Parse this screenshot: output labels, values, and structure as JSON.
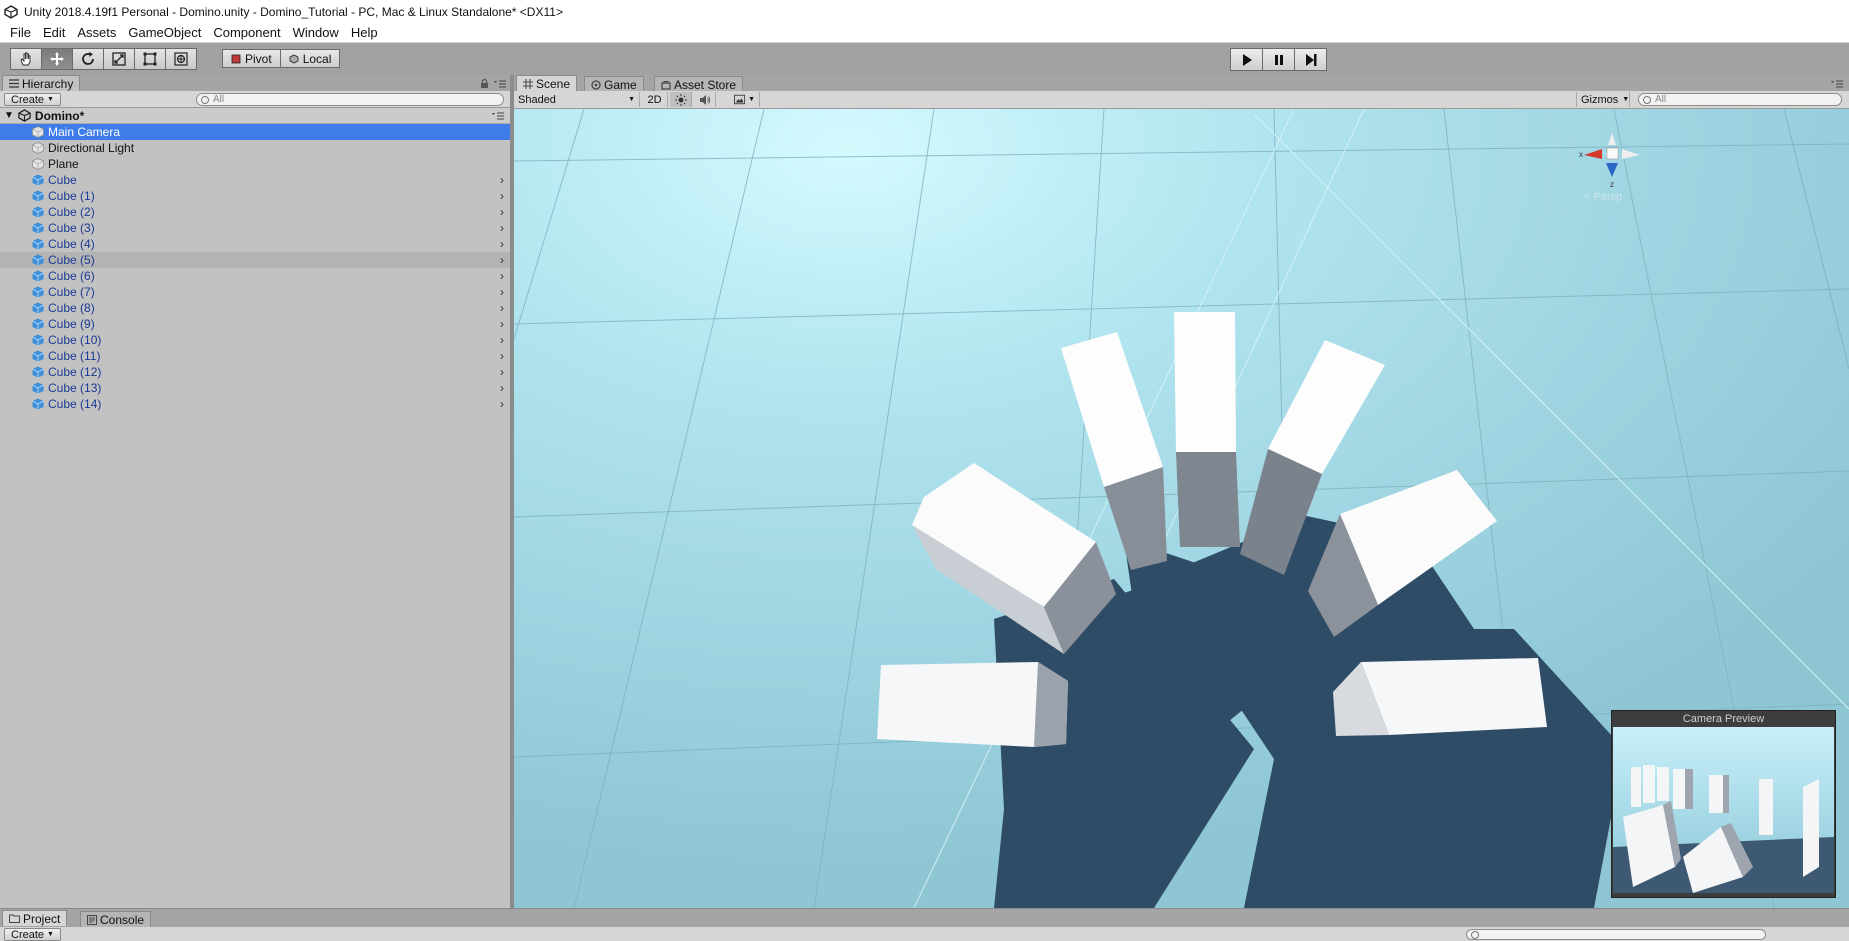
{
  "window": {
    "title": "Unity 2018.4.19f1 Personal - Domino.unity - Domino_Tutorial - PC, Mac & Linux Standalone* <DX11>"
  },
  "menu": [
    "File",
    "Edit",
    "Assets",
    "GameObject",
    "Component",
    "Window",
    "Help"
  ],
  "toolbar": {
    "tools": [
      "hand-icon",
      "move-icon",
      "rotate-icon",
      "scale-icon",
      "rect-icon",
      "transform-icon"
    ],
    "active_tool": "move-icon",
    "pivot_label": "Pivot",
    "local_label": "Local",
    "play_controls": [
      "play-icon",
      "pause-icon",
      "step-icon"
    ]
  },
  "hierarchy": {
    "tab_label": "Hierarchy",
    "create_label": "Create",
    "search_placeholder": "All",
    "scene_name": "Domino*",
    "items": [
      {
        "label": "Main Camera",
        "icon": "gameobject-icon",
        "selected": true
      },
      {
        "label": "Directional Light",
        "icon": "gameobject-icon"
      },
      {
        "label": "Plane",
        "icon": "gameobject-icon"
      },
      {
        "label": "Cube",
        "icon": "prefab-icon",
        "prefab": true
      },
      {
        "label": "Cube (1)",
        "icon": "prefab-icon",
        "prefab": true
      },
      {
        "label": "Cube (2)",
        "icon": "prefab-icon",
        "prefab": true
      },
      {
        "label": "Cube (3)",
        "icon": "prefab-icon",
        "prefab": true
      },
      {
        "label": "Cube (4)",
        "icon": "prefab-icon",
        "prefab": true
      },
      {
        "label": "Cube (5)",
        "icon": "prefab-icon",
        "prefab": true,
        "hovered": true
      },
      {
        "label": "Cube (6)",
        "icon": "prefab-icon",
        "prefab": true
      },
      {
        "label": "Cube (7)",
        "icon": "prefab-icon",
        "prefab": true
      },
      {
        "label": "Cube (8)",
        "icon": "prefab-icon",
        "prefab": true
      },
      {
        "label": "Cube (9)",
        "icon": "prefab-icon",
        "prefab": true
      },
      {
        "label": "Cube (10)",
        "icon": "prefab-icon",
        "prefab": true
      },
      {
        "label": "Cube (11)",
        "icon": "prefab-icon",
        "prefab": true
      },
      {
        "label": "Cube (12)",
        "icon": "prefab-icon",
        "prefab": true
      },
      {
        "label": "Cube (13)",
        "icon": "prefab-icon",
        "prefab": true
      },
      {
        "label": "Cube (14)",
        "icon": "prefab-icon",
        "prefab": true
      }
    ]
  },
  "scene_view": {
    "tabs": [
      "Scene",
      "Game",
      "Asset Store"
    ],
    "active_tab": "Scene",
    "shading_mode": "Shaded",
    "mode_2d_label": "2D",
    "gizmos_label": "Gizmos",
    "search_placeholder": "All",
    "gizmo_axes": {
      "x": "x",
      "z": "z"
    },
    "projection_label": "Persp",
    "camera_preview_title": "Camera Preview"
  },
  "bottom_panel": {
    "tabs": [
      "Project",
      "Console"
    ],
    "create_label": "Create"
  },
  "colors": {
    "selection": "#3e7de9",
    "panel": "#c2c2c2",
    "sky": "#9fd3e0",
    "shadow": "#2f4c66",
    "prefab_text": "#1b3a94"
  }
}
